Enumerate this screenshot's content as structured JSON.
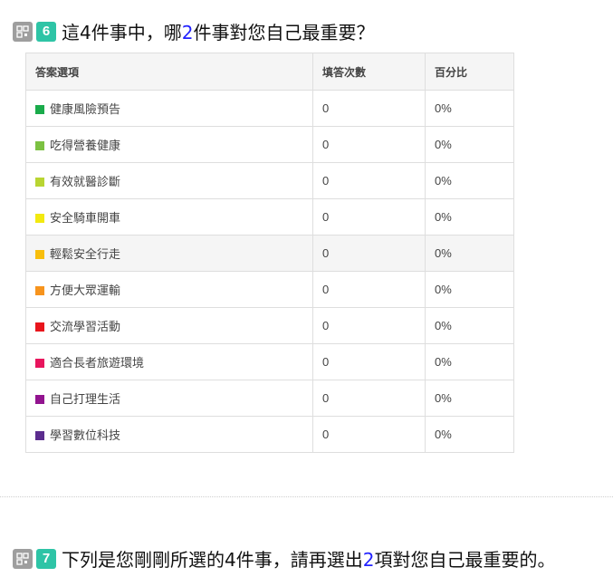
{
  "q6": {
    "number": "6",
    "title_before": "這4件事中，哪",
    "title_highlight": "2",
    "title_after": "件事對您自己最重要？"
  },
  "table": {
    "headers": [
      "答案選項",
      "填答次數",
      "百分比"
    ],
    "rows": [
      {
        "label": "健康風險預告",
        "count": "0",
        "percent": "0%",
        "color": "#1aab4b"
      },
      {
        "label": "吃得營養健康",
        "count": "0",
        "percent": "0%",
        "color": "#7cc142"
      },
      {
        "label": "有效就醫診斷",
        "count": "0",
        "percent": "0%",
        "color": "#b9d532"
      },
      {
        "label": "安全騎車開車",
        "count": "0",
        "percent": "0%",
        "color": "#f2e90f"
      },
      {
        "label": "輕鬆安全行走",
        "count": "0",
        "percent": "0%",
        "color": "#f8be0c"
      },
      {
        "label": "方便大眾運輸",
        "count": "0",
        "percent": "0%",
        "color": "#f7941d"
      },
      {
        "label": "交流學習活動",
        "count": "0",
        "percent": "0%",
        "color": "#e8151c"
      },
      {
        "label": "適合長者旅遊環境",
        "count": "0",
        "percent": "0%",
        "color": "#e8155d"
      },
      {
        "label": "自己打理生活",
        "count": "0",
        "percent": "0%",
        "color": "#92148f"
      },
      {
        "label": "學習數位科技",
        "count": "0",
        "percent": "0%",
        "color": "#5b2c8e"
      }
    ]
  },
  "q7": {
    "number": "7",
    "title_before": "下列是您剛剛所選的4件事，請再選出",
    "title_highlight": "2",
    "title_after": "項對您自己最重要的。"
  }
}
